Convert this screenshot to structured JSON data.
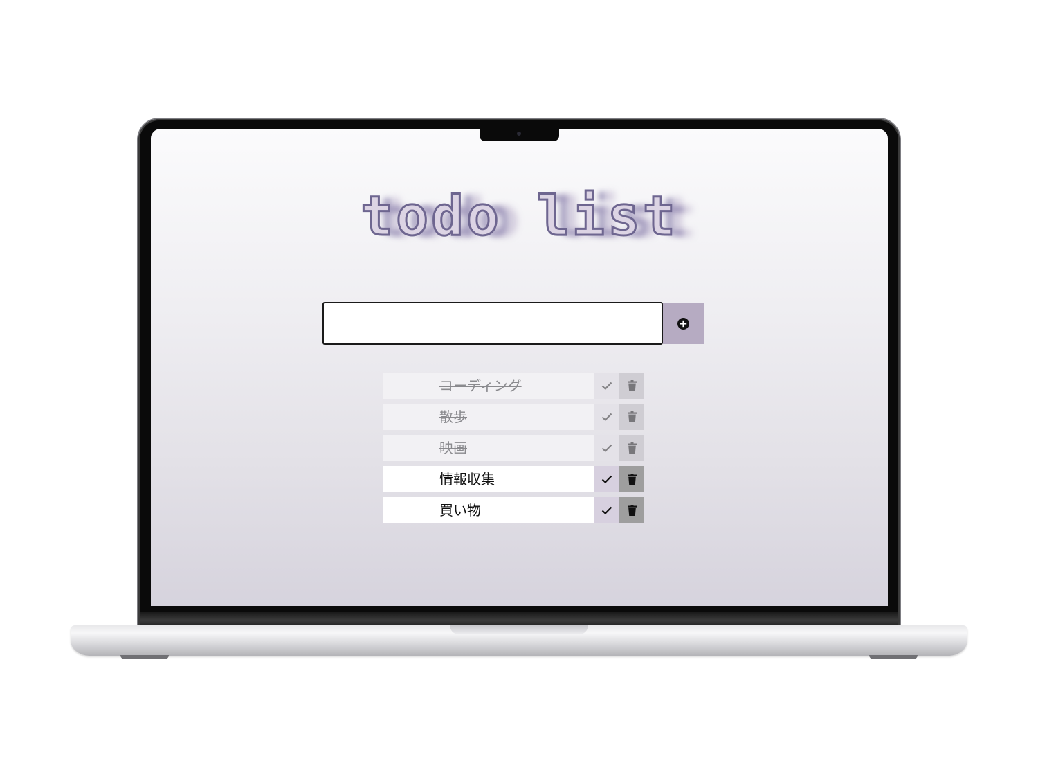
{
  "app": {
    "title": "todo list"
  },
  "input": {
    "value": "",
    "placeholder": ""
  },
  "add_button": {
    "icon": "plus-circle-icon"
  },
  "todos": [
    {
      "text": "コーディング",
      "done": true
    },
    {
      "text": "散歩",
      "done": true
    },
    {
      "text": "映画",
      "done": true
    },
    {
      "text": "情報収集",
      "done": false
    },
    {
      "text": "買い物",
      "done": false
    }
  ],
  "row_buttons": {
    "complete_icon": "check-icon",
    "delete_icon": "trash-icon"
  },
  "colors": {
    "title_stroke": "#6e6690",
    "add_button_bg": "#b6abc2",
    "check_button_bg": "#d7d0df",
    "delete_button_bg": "#9e9e9e"
  }
}
